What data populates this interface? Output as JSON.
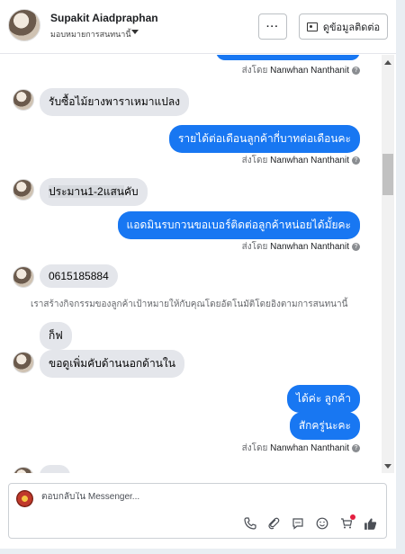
{
  "header": {
    "name": "Supakit Aiadpraphan",
    "subtitle": "มอบหมายการสนทนานี้",
    "more_label": "···",
    "contact_label": "ดูข้อมูลติดต่อ"
  },
  "messages": {
    "sent_prefix": "ส่งโดย",
    "agent": "Nanwhan Nanthanit",
    "m1": "รับซื้อไม้ยางพาราเหมาแปลง",
    "m2": "รายได้ต่อเดือนลูกค้ากี่บาทต่อเดือนคะ",
    "m3_hl": "ประมาน1-2แสน",
    "m3_rest": "คับ",
    "m4": "แอดมินรบกวนขอเบอร์ติดต่อลูกค้าหน่อยได้มั้ยคะ",
    "m5": "0615185884",
    "system": "เราสร้างกิจกรรมของลูกค้าเป้าหมายให้กับคุณโดยอัตโนมัติโดยอิงตามการสนทนานี้",
    "m6": "ก็ฟ",
    "m7": "ขอดูเพิ่มคับด้านนอกด้านใน",
    "m8": "ได้ค่ะ ลูกค้า",
    "m9": "สักครู่นะคะ"
  },
  "composer": {
    "placeholder": "ตอบกลับใน Messenger..."
  },
  "colors": {
    "outgoing": "#1877f2",
    "incoming": "#e4e6eb"
  }
}
